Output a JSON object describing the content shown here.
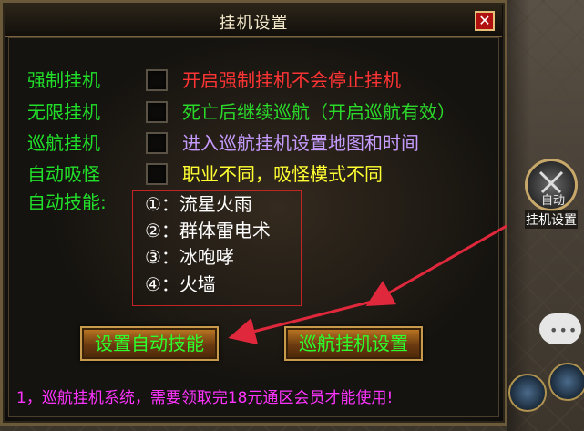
{
  "window": {
    "title": "挂机设置",
    "close_label": "✕"
  },
  "settings": [
    {
      "label": "强制挂机",
      "desc": "开启强制挂机不会停止挂机",
      "desc_color": "red"
    },
    {
      "label": "无限挂机",
      "desc": "死亡后继续巡航（开启巡航有效）",
      "desc_color": "green"
    },
    {
      "label": "巡航挂机",
      "desc": "进入巡航挂机设置地图和时间",
      "desc_color": "violet"
    },
    {
      "label": "自动吸怪",
      "desc": "职业不同，吸怪模式不同",
      "desc_color": "yellow"
    }
  ],
  "auto_skills": {
    "label": "自动技能:",
    "items": [
      "①：流星火雨",
      "②：群体雷电术",
      "③：冰咆哮",
      "④：火墙"
    ]
  },
  "buttons": {
    "set_skills": "设置自动技能",
    "patrol_settings": "巡航挂机设置"
  },
  "footer": "1，巡航挂机系统，需要领取完18元通区会员才能使用!",
  "hud": {
    "auto_button_text": "自动",
    "auto_caption": "挂机设置",
    "chat_dots": "•••"
  },
  "colors": {
    "label_green": "#21e02a",
    "red": "#ff3434",
    "violet": "#c69bff",
    "yellow": "#ffff33",
    "footer_magenta": "#ff33ff",
    "arrow_red": "#e0283c"
  }
}
